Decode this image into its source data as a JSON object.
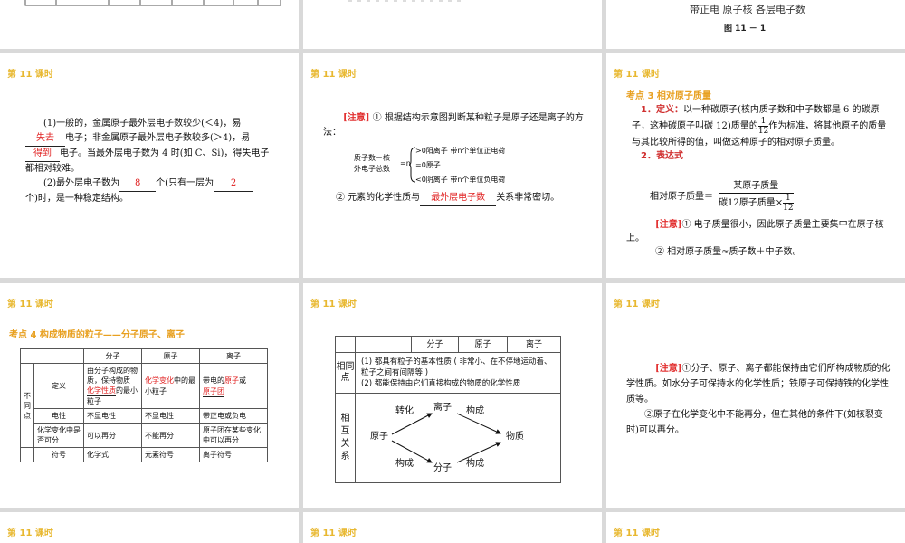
{
  "top_right": {
    "label_line": "带正电   原子核   各层电子数",
    "figure_caption": "图 11 － 1"
  },
  "lesson_label": "第 11 课时",
  "slide_a": {
    "p1_a": "(1)一般的，金属原子最外层电子数较少(＜4)，易",
    "blank1": "失去",
    "p1_b": "电子；非金属原子最外层电子数较多(＞4)，易",
    "blank2": "得到",
    "p1_c": "电子。当最外层电子数为 4 时(如 C、Si)，得失电子都相对较难。",
    "p2_a": "(2)最外层电子数为",
    "blank3": "8",
    "p2_b": "个(只有一层为",
    "blank4": "2",
    "p2_c": "个)时，是一种稳定结构。"
  },
  "slide_b": {
    "note_tag": "[注意]",
    "note_text": "① 根据结构示意图判断某种粒子是原子还是离子的方法：",
    "diagram_left": [
      "质子数－核",
      "外电子总数"
    ],
    "diagram_eq": "=n",
    "diagram_right": [
      ">0阳离子    带n个单位正电荷",
      "=0原子",
      "<0阴离子    带n个单位负电荷"
    ],
    "p2_a": "② 元素的化学性质与",
    "blank": "最外层电子数",
    "p2_b": "关系非常密切。"
  },
  "slide_c": {
    "heading": "考点 3    相对原子质量",
    "def_label": "1．定义：",
    "def_text_a": "以一种碳原子(核内质子数和中子数都是 6 的碳原子，这种碳原子叫碳 12)质量的",
    "frac_num": "1",
    "frac_den": "12",
    "def_text_b": "作为标准，将其他原子的质量与其比较所得的值，叫做这种原子的相对原子质量。",
    "expr_label": "2．表达式",
    "expr_lhs": "相对原子质量＝",
    "expr_num": "某原子质量",
    "expr_den": "碳12原子质量×",
    "expr_frac_num": "1",
    "expr_frac_den": "12",
    "note_tag": "[注意]",
    "note1": "① 电子质量很小，因此原子质量主要集中在原子核上。",
    "note2": "② 相对原子质量≈质子数＋中子数。"
  },
  "slide_d": {
    "heading": "考点 4    构成物质的粒子——分子原子、离子",
    "cols": [
      "分子",
      "原子",
      "离子"
    ],
    "side": "不同点",
    "rows": [
      {
        "name": "定义",
        "mol_a": "由分子构成的物质，保持物质",
        "mol_blank": "化学性质",
        "mol_b": "的最小粒子",
        "atom_blank": "化学变化",
        "atom_b": "中的最小粒子",
        "ion_a": "带电的",
        "ion_blank1": "原子",
        "ion_mid": "或",
        "ion_blank2": "原子团"
      },
      {
        "name": "电性",
        "mol": "不显电性",
        "atom": "不显电性",
        "ion": "带正电或负电"
      },
      {
        "name": "化学变化中是否可分",
        "mol": "可以再分",
        "atom": "不能再分",
        "ion": "原子团在某些变化中可以再分"
      },
      {
        "name": "符号",
        "mol": "化学式",
        "atom": "元素符号",
        "ion": "离子符号"
      }
    ]
  },
  "slide_e": {
    "cols": [
      "分子",
      "原子",
      "离子"
    ],
    "same_label": "相同点",
    "same_1": "(1) 都具有粒子的基本性质 ( 非常小、在不停地运动着、粒子之间有间隔等 )",
    "same_2": "(2) 都能保持由它们直接构成的物质的化学性质",
    "rel_label": "相互关系",
    "rel_nodes": {
      "atom": "原子",
      "ion": "离子",
      "molecule": "分子",
      "matter": "物质"
    },
    "rel_edges": {
      "transform": "转化",
      "compose1": "构成",
      "compose2": "构成",
      "compose3": "构成"
    }
  },
  "slide_f": {
    "note_tag": "[注意]",
    "p1": "①分子、原子、离子都能保持由它们所构成物质的化学性质。如水分子可保持水的化学性质；铁原子可保持铁的化学性质等。",
    "p2": "②原子在化学变化中不能再分，但在其他的条件下(如核裂变时)可以再分。"
  }
}
